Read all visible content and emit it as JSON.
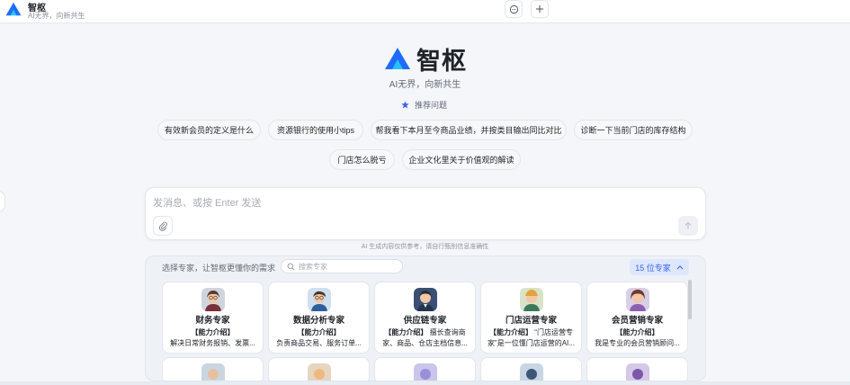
{
  "app": {
    "title": "智枢",
    "subtitle": "AI无界，向新共生"
  },
  "header_icons": [
    "chat-bubble-icon",
    "plus-icon"
  ],
  "brand": {
    "name": "智枢",
    "tagline": "AI无界，向新共生"
  },
  "recommend": {
    "title": "推荐问题"
  },
  "chips": [
    "有效新会员的定义是什么",
    "资源银行的使用小tips",
    "帮我看下本月至今商品业绩，并按类目输出同比对比",
    "诊断一下当前门店的库存结构",
    "门店怎么脱亏",
    "企业文化里关于价值观的解读"
  ],
  "input": {
    "placeholder": "发消息、或按 Enter 发送"
  },
  "disclaimer": "AI 生成内容仅供参考，请自行甄别信息准确性",
  "experts": {
    "hint": "选择专家，让智枢更懂你的需求",
    "search_placeholder": "搜索专家",
    "count_label": "15 位专家",
    "cards": [
      {
        "name": "财务专家",
        "intro_label": "【能力介绍】",
        "desc": "解决日常财务报销、发票..."
      },
      {
        "name": "数据分析专家",
        "intro_label": "【能力介绍】",
        "desc": "负责商品交易、服务订单..."
      },
      {
        "name": "供应链专家",
        "intro_label": "【能力介绍】",
        "desc": "擅长查询商家、商品、仓店主档信息..."
      },
      {
        "name": "门店运营专家",
        "intro_label": "【能力介绍】",
        "desc": "“门店运营专家”是一位懂门店运营的AI..."
      },
      {
        "name": "会员营销专家",
        "intro_label": "【能力介绍】",
        "desc": "我是专业的会员营销顾问..."
      }
    ]
  },
  "colors": {
    "accent": "#3a64e8",
    "logo_blue": "#1e6cff",
    "logo_cyan": "#27c2f5"
  }
}
